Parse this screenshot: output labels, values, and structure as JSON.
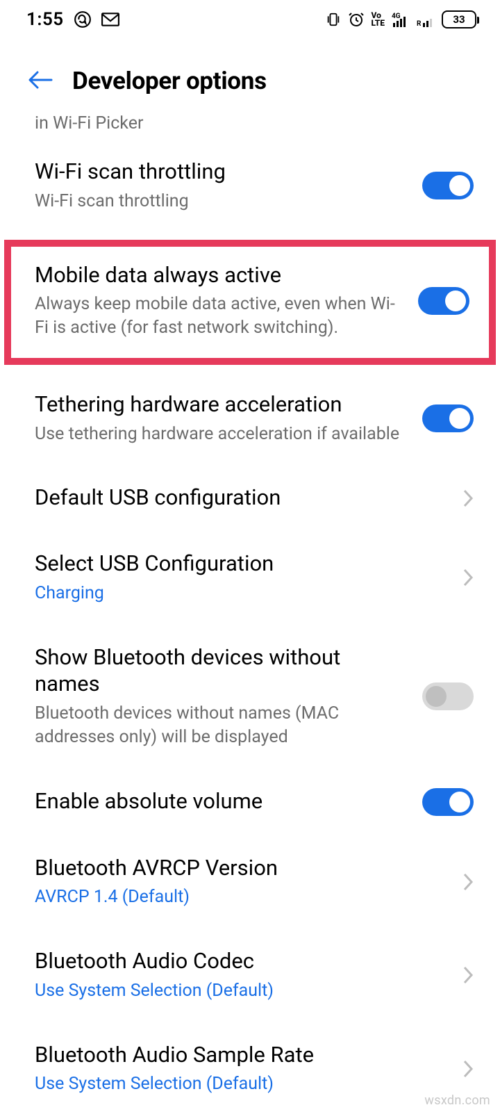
{
  "status": {
    "time": "1:55",
    "battery": "33"
  },
  "header": {
    "title": "Developer options"
  },
  "partial": "in Wi-Fi Picker",
  "rows": {
    "wifi_throttle": {
      "title": "Wi-Fi scan throttling",
      "sub": "Wi-Fi scan throttling"
    },
    "mobile_data": {
      "title": "Mobile data always active",
      "sub": "Always keep mobile data active, even when Wi-Fi is active (for fast network switching)."
    },
    "tethering": {
      "title": "Tethering hardware acceleration",
      "sub": "Use tethering hardware acceleration if available"
    },
    "usb_default": {
      "title": "Default USB configuration"
    },
    "usb_select": {
      "title": "Select USB Configuration",
      "sub": "Charging"
    },
    "bt_noname": {
      "title": "Show Bluetooth devices without names",
      "sub": "Bluetooth devices without names (MAC addresses only) will be displayed"
    },
    "abs_volume": {
      "title": "Enable absolute volume"
    },
    "avrcp": {
      "title": "Bluetooth AVRCP Version",
      "sub": "AVRCP 1.4 (Default)"
    },
    "codec": {
      "title": "Bluetooth Audio Codec",
      "sub": "Use System Selection (Default)"
    },
    "sample": {
      "title": "Bluetooth Audio Sample Rate",
      "sub": "Use System Selection (Default)"
    }
  },
  "watermark": "wsxdn.com"
}
